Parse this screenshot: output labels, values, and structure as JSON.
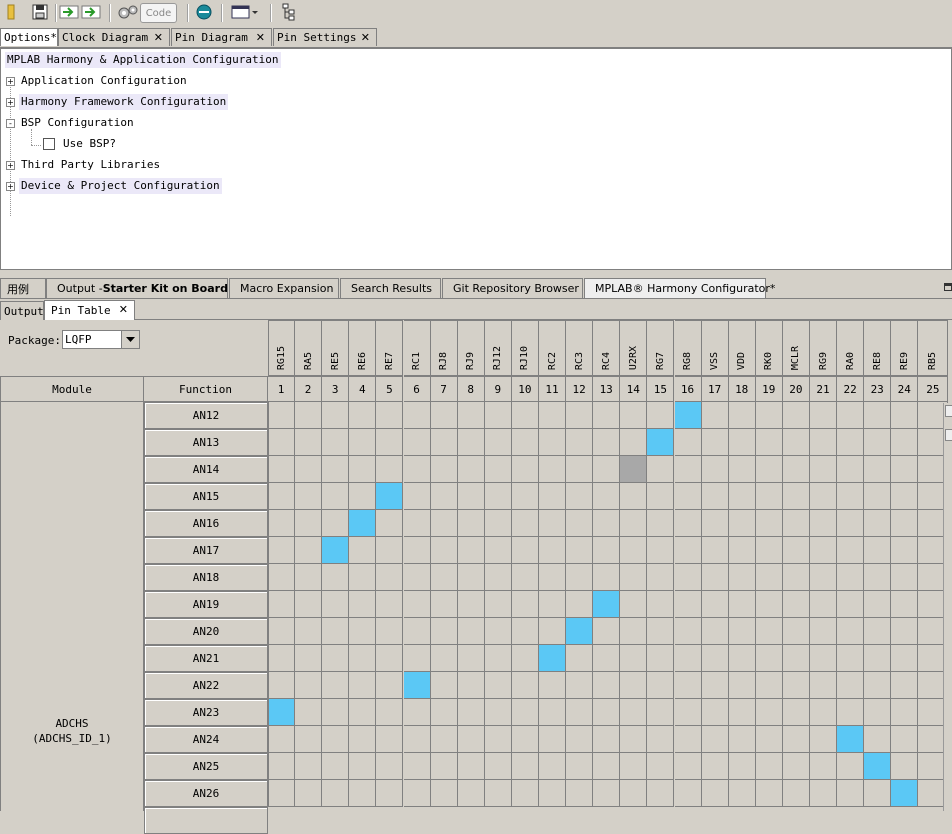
{
  "toolbar": {
    "code_label": "Code",
    "icons": [
      "folder-icon",
      "save-icon",
      "arrow-left-icon",
      "arrow-right-icon",
      "gears-icon",
      "code-icon",
      "harmony-icon",
      "window-icon",
      "tree-icon"
    ]
  },
  "top_tabs": [
    {
      "label": "Options*",
      "closable": false,
      "active": true
    },
    {
      "label": "Clock Diagram",
      "closable": true,
      "active": false
    },
    {
      "label": "Pin Diagram",
      "closable": true,
      "active": false
    },
    {
      "label": "Pin Settings",
      "closable": true,
      "active": false
    }
  ],
  "tree": {
    "root": "MPLAB Harmony & Application Configuration",
    "items": [
      {
        "label": "Application Configuration",
        "expander": "+",
        "highlight": false
      },
      {
        "label": "Harmony Framework Configuration",
        "expander": "+",
        "highlight": true
      },
      {
        "label": "BSP Configuration",
        "expander": "-",
        "highlight": false
      },
      {
        "label": "Third Party Libraries",
        "expander": "+",
        "highlight": false
      },
      {
        "label": "Device & Project Configuration",
        "expander": "+",
        "highlight": true
      }
    ],
    "bsp_checkbox": {
      "label": "Use BSP?",
      "checked": false
    }
  },
  "output_tabs": [
    {
      "label": "用例"
    },
    {
      "label_prefix": "Output - ",
      "label_bold": "Starter Kit on Board"
    },
    {
      "label": "Macro Expansion"
    },
    {
      "label": "Search Results"
    },
    {
      "label": "Git Repository Browser"
    },
    {
      "label": "MPLAB® Harmony Configurator*",
      "active": true
    }
  ],
  "sub_tabs": [
    {
      "label": "Output",
      "closable": false
    },
    {
      "label": "Pin Table",
      "closable": true,
      "active": true
    }
  ],
  "package": {
    "label": "Package:",
    "value": "LQFP"
  },
  "table": {
    "module_header": "Module",
    "function_header": "Function",
    "pins": [
      {
        "num": "1",
        "name": "RG15"
      },
      {
        "num": "2",
        "name": "RA5"
      },
      {
        "num": "3",
        "name": "RE5"
      },
      {
        "num": "4",
        "name": "RE6"
      },
      {
        "num": "5",
        "name": "RE7"
      },
      {
        "num": "6",
        "name": "RC1"
      },
      {
        "num": "7",
        "name": "RJ8"
      },
      {
        "num": "8",
        "name": "RJ9"
      },
      {
        "num": "9",
        "name": "RJ12"
      },
      {
        "num": "10",
        "name": "RJ10"
      },
      {
        "num": "11",
        "name": "RC2"
      },
      {
        "num": "12",
        "name": "RC3"
      },
      {
        "num": "13",
        "name": "RC4"
      },
      {
        "num": "14",
        "name": "U2RX"
      },
      {
        "num": "15",
        "name": "RG7"
      },
      {
        "num": "16",
        "name": "RG8"
      },
      {
        "num": "17",
        "name": "VSS"
      },
      {
        "num": "18",
        "name": "VDD"
      },
      {
        "num": "19",
        "name": "RK0"
      },
      {
        "num": "20",
        "name": "MCLR"
      },
      {
        "num": "21",
        "name": "RG9"
      },
      {
        "num": "22",
        "name": "RA0"
      },
      {
        "num": "23",
        "name": "RE8"
      },
      {
        "num": "24",
        "name": "RE9"
      },
      {
        "num": "25",
        "name": "RB5"
      }
    ],
    "module": {
      "name": "ADCHS",
      "id": "(ADCHS_ID_1)"
    },
    "rows": [
      {
        "function": "AN12",
        "pin": 16,
        "state": "on"
      },
      {
        "function": "AN13",
        "pin": 15,
        "state": "on"
      },
      {
        "function": "AN14",
        "pin": 14,
        "state": "grey"
      },
      {
        "function": "AN15",
        "pin": 5,
        "state": "on"
      },
      {
        "function": "AN16",
        "pin": 4,
        "state": "on"
      },
      {
        "function": "AN17",
        "pin": 3,
        "state": "on"
      },
      {
        "function": "AN18",
        "pin": null,
        "state": "none"
      },
      {
        "function": "AN19",
        "pin": 13,
        "state": "on"
      },
      {
        "function": "AN20",
        "pin": 12,
        "state": "on"
      },
      {
        "function": "AN21",
        "pin": 11,
        "state": "on"
      },
      {
        "function": "AN22",
        "pin": 6,
        "state": "on"
      },
      {
        "function": "AN23",
        "pin": 1,
        "state": "on"
      },
      {
        "function": "AN24",
        "pin": 22,
        "state": "on"
      },
      {
        "function": "AN25",
        "pin": 23,
        "state": "on"
      },
      {
        "function": "AN26",
        "pin": 24,
        "state": "on"
      }
    ],
    "colors": {
      "assigned": "#5bc8f5",
      "unavailable": "#a8a8a8",
      "cell": "#d4d0c8"
    }
  }
}
